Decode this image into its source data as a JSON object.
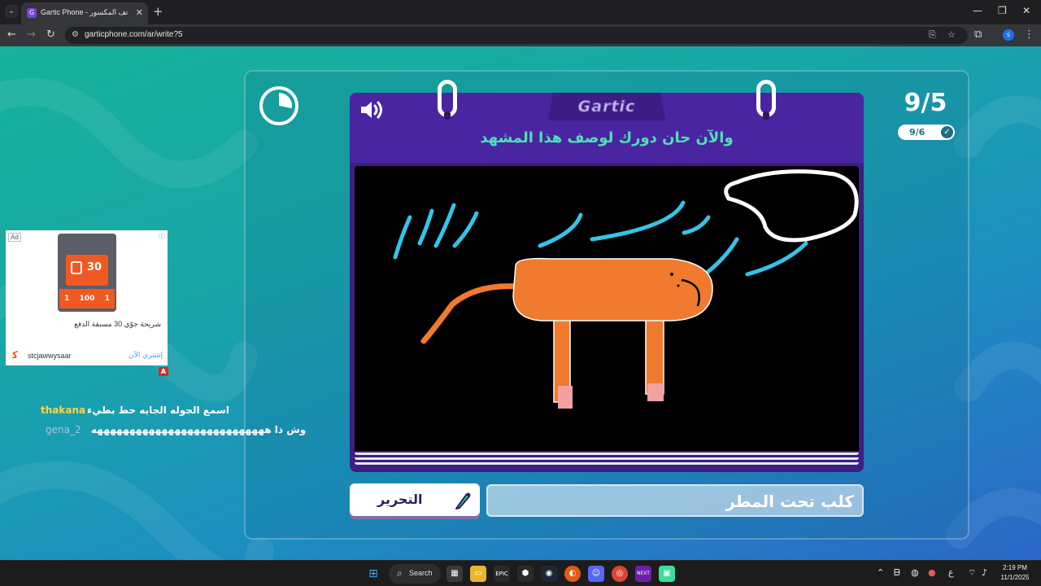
{
  "browser": {
    "tab_title": "Gartic Phone - الهاتف المكسور",
    "url": "garticphone.com/ar/write?5",
    "tab_icon_letter": "G"
  },
  "game": {
    "brand": "Gartic",
    "instruction": "والآن حان دورك لوصف هذا المشهد",
    "round": "9/5",
    "players_ready": "9/6",
    "timer_elapsed_fraction": 0.28,
    "edit_button_label": "التحرير",
    "answer_value": "كلب تحت المطر",
    "colors": {
      "accent": "#4ee0b6",
      "card": "#4a25a2",
      "dog": "#f07a2e",
      "rain": "#36c3e6"
    }
  },
  "ad": {
    "badge": "Ad",
    "sim_big": "30",
    "sim_row": [
      "1",
      "100",
      "1"
    ],
    "caption": "شريحة جوّي 30 مسبقة الدفع",
    "brand": "stcjawwysaar",
    "cta": "إشتري الآن",
    "choice": "A"
  },
  "chat": [
    {
      "user": "thakana",
      "message": "اسمع الجوله الجايه حط بطيء",
      "user_color": "#ffd54a"
    },
    {
      "user": "gena_2",
      "message": "وش ذا هههههههههههههههههههههههههههه",
      "user_color": "#a9c3dd"
    }
  ],
  "taskbar": {
    "search_label": "Search",
    "time": "2:19 PM",
    "date": "11/1/2025",
    "ime": "ع"
  }
}
